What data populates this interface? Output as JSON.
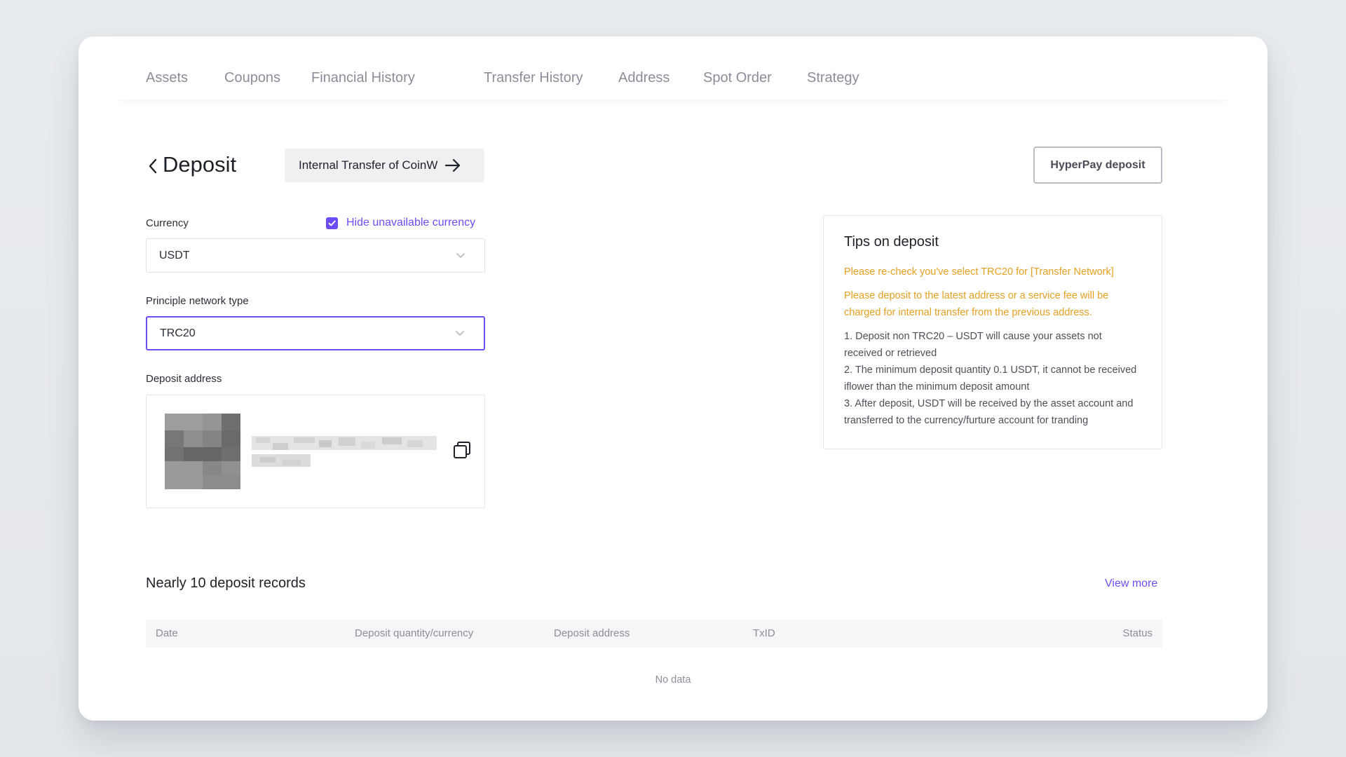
{
  "nav": {
    "tabs": [
      "Assets",
      "Coupons",
      "Financial History",
      "Transfer History",
      "Address",
      "Spot Order",
      "Strategy"
    ]
  },
  "header": {
    "title": "Deposit",
    "internal_transfer_label": "Internal Transfer of CoinW",
    "hyperpay_label": "HyperPay deposit"
  },
  "form": {
    "currency_label": "Currency",
    "hide_unavailable_label": "Hide unavailable currency",
    "hide_unavailable_checked": true,
    "currency_value": "USDT",
    "network_label": "Principle network type",
    "network_value": "TRC20",
    "address_label": "Deposit address"
  },
  "tips": {
    "title": "Tips on deposit",
    "warnings": [
      "Please re-check you've select TRC20 for [Transfer Network]",
      "Please deposit to the latest address or a service fee will be charged for internal transfer from the previous address."
    ],
    "notes": [
      "1. Deposit non TRC20 – USDT will cause your assets not received or retrieved",
      "2. The minimum deposit quantity 0.1 USDT, it cannot be received iflower than the minimum deposit amount",
      "3. After deposit, USDT will be received by the asset account and transferred to the currency/furture account for tranding"
    ]
  },
  "records": {
    "title": "Nearly 10 deposit records",
    "view_more": "View more",
    "columns": [
      "Date",
      "Deposit quantity/currency",
      "Deposit address",
      "TxID",
      "Status"
    ],
    "empty_text": "No data"
  },
  "colors": {
    "accent": "#6c4cf5",
    "warning": "#e6a021"
  },
  "icons": {
    "back": "chevron-left-icon",
    "transfer_arrow": "arrow-right-icon",
    "dropdown": "chevron-down-icon",
    "copy": "copy-icon",
    "checkbox": "check-icon"
  }
}
